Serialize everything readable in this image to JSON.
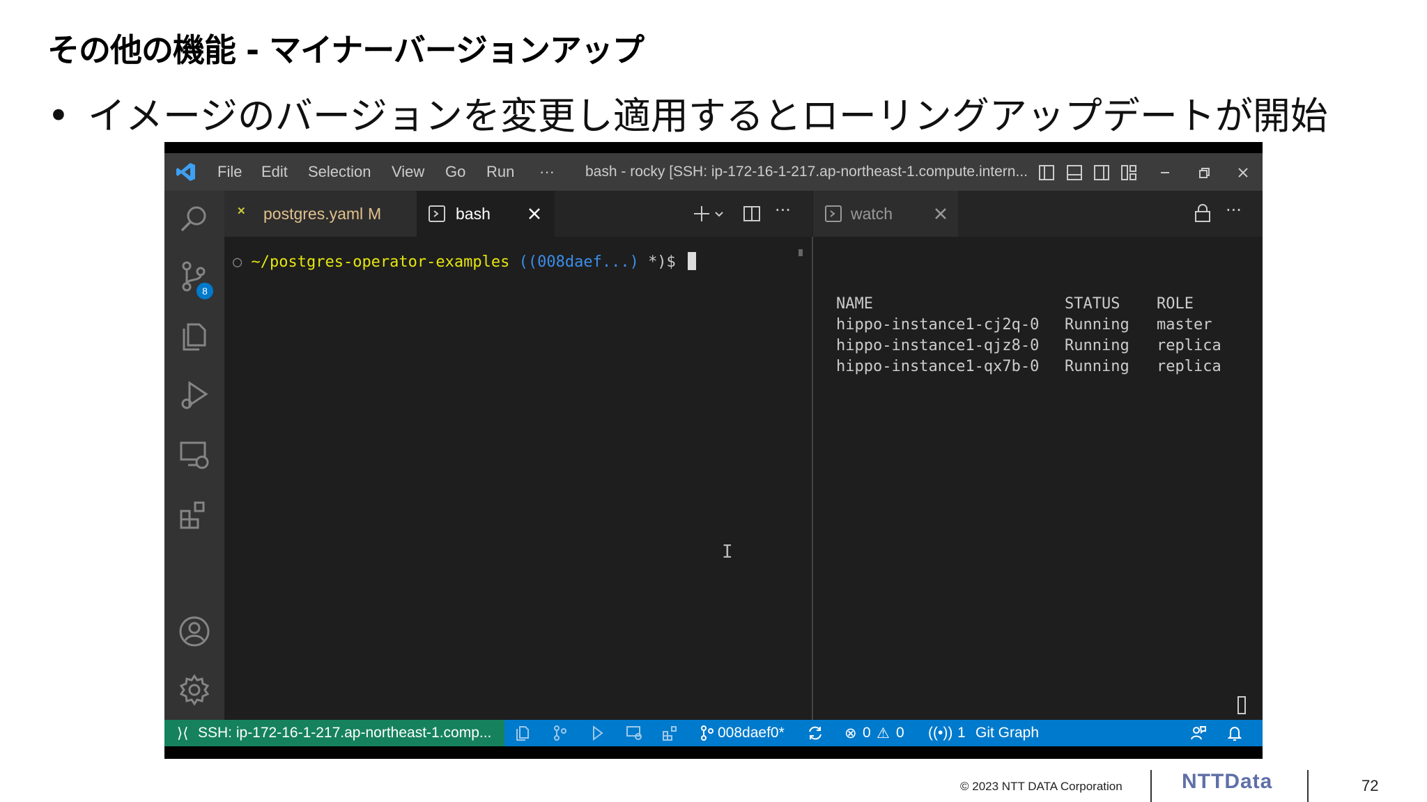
{
  "slide": {
    "title": "その他の機能 - マイナーバージョンアップ",
    "bullet": "イメージのバージョンを変更し適用するとローリングアップデートが開始"
  },
  "window": {
    "menu": [
      "File",
      "Edit",
      "Selection",
      "View",
      "Go",
      "Run",
      "···"
    ],
    "title": "bash - rocky [SSH: ip-172-16-1-217.ap-northeast-1.compute.intern..."
  },
  "activity_bar": {
    "scm_badge": "8"
  },
  "tabs": {
    "yaml_label": "postgres.yaml",
    "yaml_modified": "M",
    "bash_label": "bash",
    "watch_label": "watch"
  },
  "terminal": {
    "path": "~/postgres-operator-examples",
    "branch": "((008daef...)",
    "suffix": "*)$"
  },
  "watch_table": {
    "headers": [
      "NAME",
      "STATUS",
      "ROLE"
    ],
    "rows": [
      [
        "hippo-instance1-cj2q-0",
        "Running",
        "master"
      ],
      [
        "hippo-instance1-qjz8-0",
        "Running",
        "replica"
      ],
      [
        "hippo-instance1-qx7b-0",
        "Running",
        "replica"
      ]
    ]
  },
  "status_bar": {
    "ssh": "SSH: ip-172-16-1-217.ap-northeast-1.comp...",
    "branch": "008daef0*",
    "errors": "0",
    "warnings": "0",
    "ports": "1",
    "git_graph": "Git Graph"
  },
  "footer": {
    "copyright": "© 2023 NTT DATA Corporation",
    "logo": "NTTData",
    "page": "72"
  },
  "colors": {
    "accent_blue": "#007acc",
    "ssh_green": "#16825d",
    "terminal_yellow": "#e5e510",
    "terminal_cyan": "#3b8eea"
  }
}
